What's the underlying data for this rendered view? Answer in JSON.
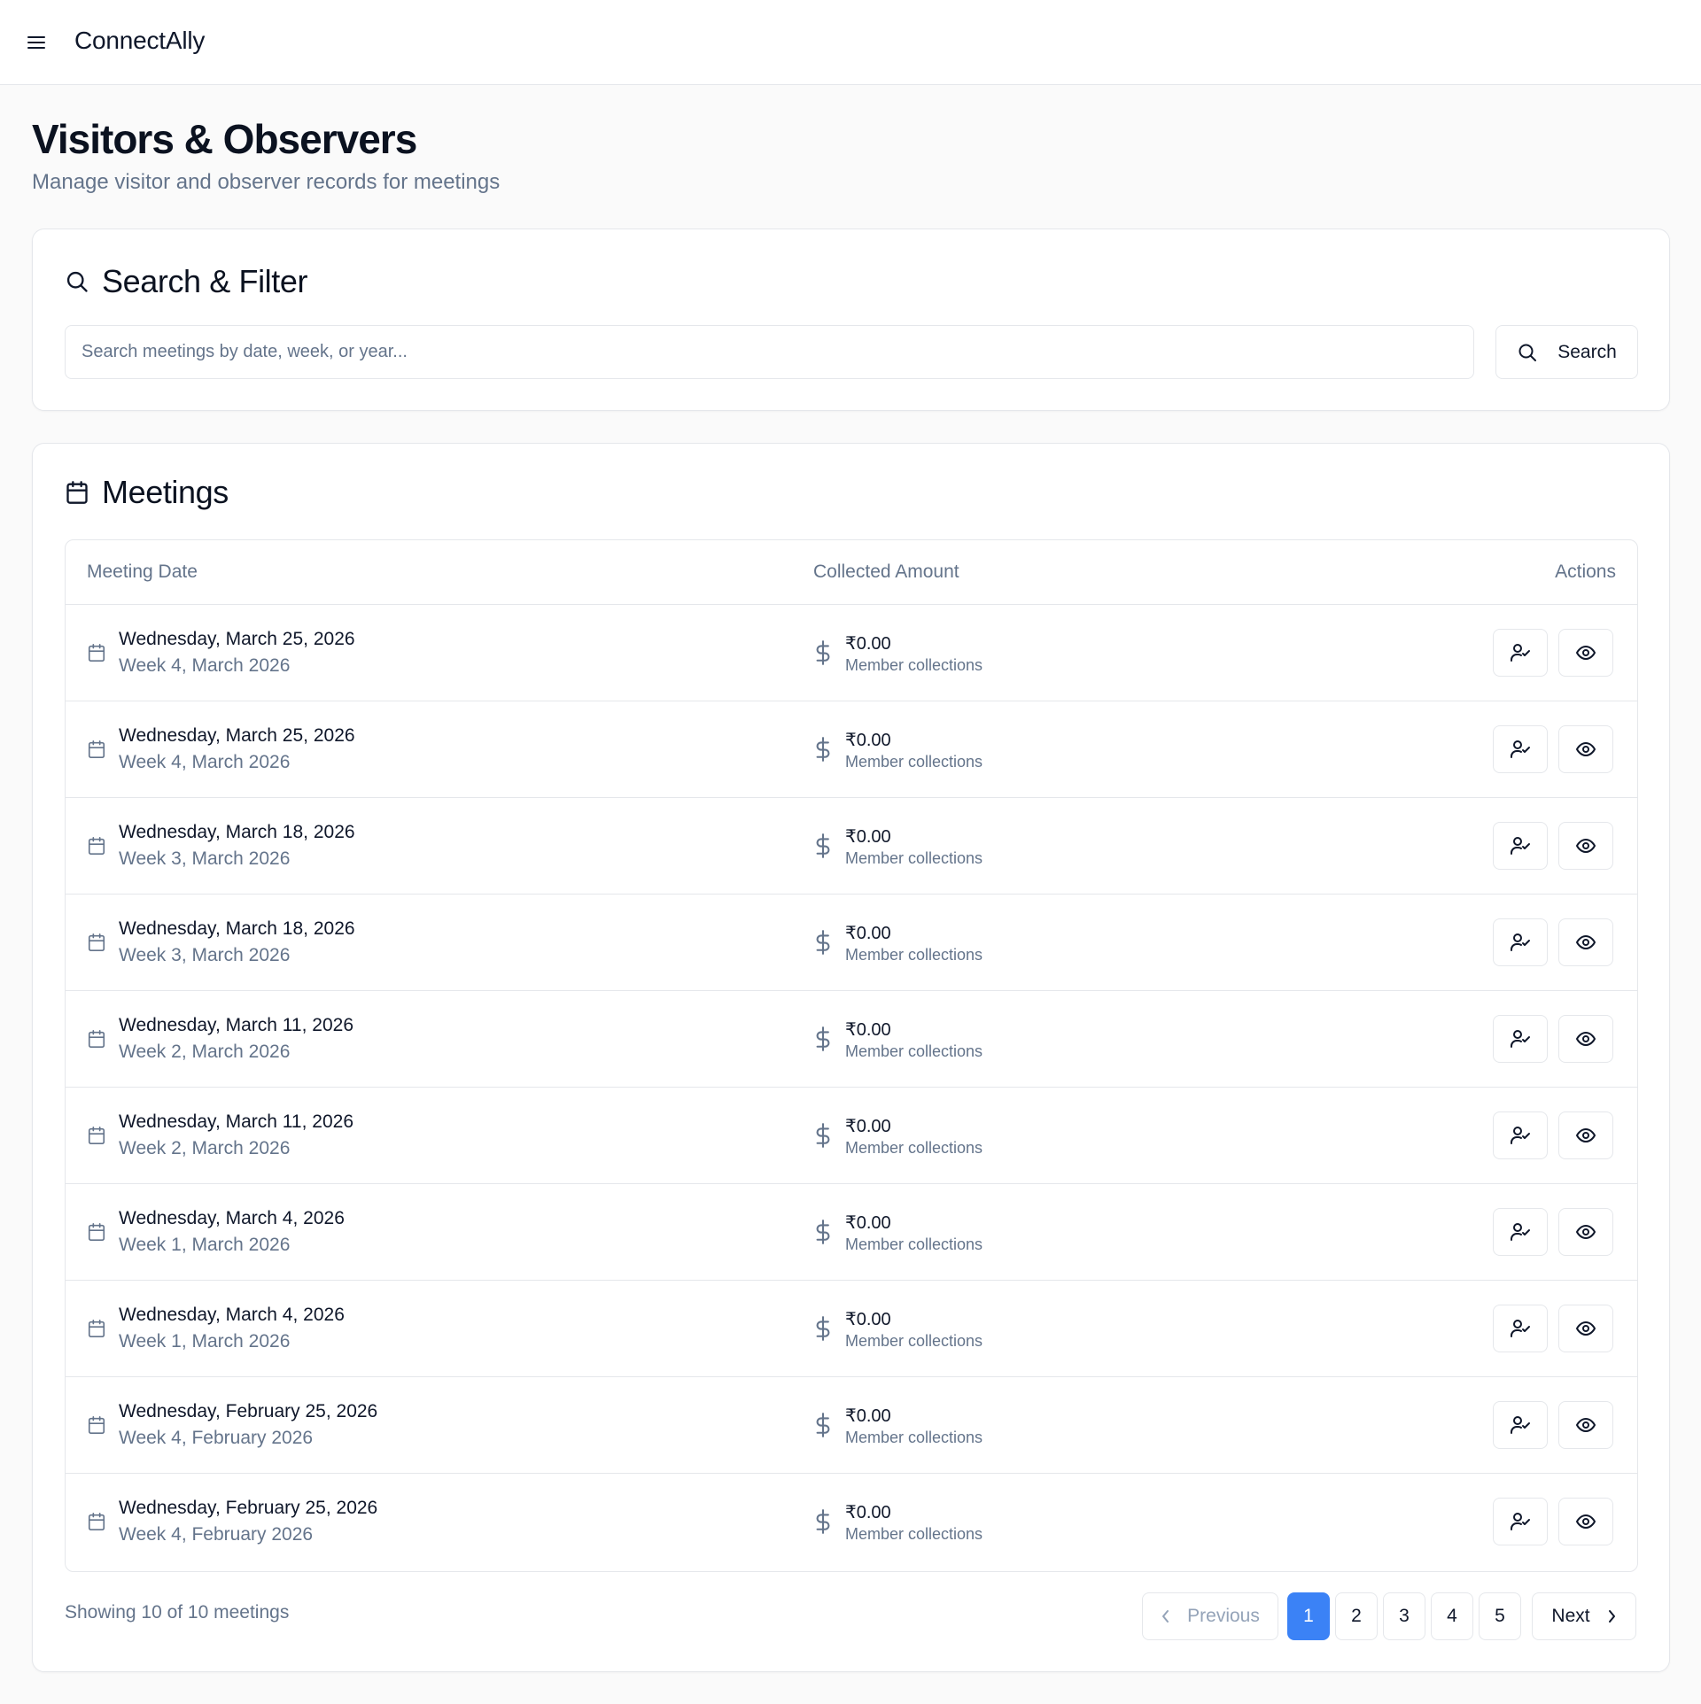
{
  "app": {
    "brand": "ConnectAlly"
  },
  "page": {
    "title": "Visitors & Observers",
    "subtitle": "Manage visitor and observer records for meetings"
  },
  "search": {
    "heading": "Search & Filter",
    "placeholder": "Search meetings by date, week, or year...",
    "value": "",
    "button_label": "Search"
  },
  "meetings": {
    "heading": "Meetings",
    "columns": {
      "date": "Meeting Date",
      "amount": "Collected Amount",
      "actions": "Actions"
    },
    "rows": [
      {
        "date": "Wednesday, March 25, 2026",
        "week": "Week 4, March 2026",
        "amount": "₹0.00",
        "amount_label": "Member collections"
      },
      {
        "date": "Wednesday, March 25, 2026",
        "week": "Week 4, March 2026",
        "amount": "₹0.00",
        "amount_label": "Member collections"
      },
      {
        "date": "Wednesday, March 18, 2026",
        "week": "Week 3, March 2026",
        "amount": "₹0.00",
        "amount_label": "Member collections"
      },
      {
        "date": "Wednesday, March 18, 2026",
        "week": "Week 3, March 2026",
        "amount": "₹0.00",
        "amount_label": "Member collections"
      },
      {
        "date": "Wednesday, March 11, 2026",
        "week": "Week 2, March 2026",
        "amount": "₹0.00",
        "amount_label": "Member collections"
      },
      {
        "date": "Wednesday, March 11, 2026",
        "week": "Week 2, March 2026",
        "amount": "₹0.00",
        "amount_label": "Member collections"
      },
      {
        "date": "Wednesday, March 4, 2026",
        "week": "Week 1, March 2026",
        "amount": "₹0.00",
        "amount_label": "Member collections"
      },
      {
        "date": "Wednesday, March 4, 2026",
        "week": "Week 1, March 2026",
        "amount": "₹0.00",
        "amount_label": "Member collections"
      },
      {
        "date": "Wednesday, February 25, 2026",
        "week": "Week 4, February 2026",
        "amount": "₹0.00",
        "amount_label": "Member collections"
      },
      {
        "date": "Wednesday, February 25, 2026",
        "week": "Week 4, February 2026",
        "amount": "₹0.00",
        "amount_label": "Member collections"
      }
    ],
    "footer_text": "Showing 10 of 10 meetings"
  },
  "pagination": {
    "previous_label": "Previous",
    "next_label": "Next",
    "pages": [
      "1",
      "2",
      "3",
      "4",
      "5"
    ],
    "current_page": "1"
  },
  "colors": {
    "accent": "#3b82f6",
    "muted_text": "#64748b",
    "border": "#e5e7eb",
    "background": "#fafafa"
  },
  "icons": {
    "menu": "hamburger-menu-icon",
    "search": "search-icon",
    "calendar": "calendar-icon",
    "dollar": "dollar-icon",
    "user_check": "user-check-icon",
    "view": "eye-icon",
    "prev": "chevron-left-icon",
    "next": "chevron-right-icon"
  }
}
